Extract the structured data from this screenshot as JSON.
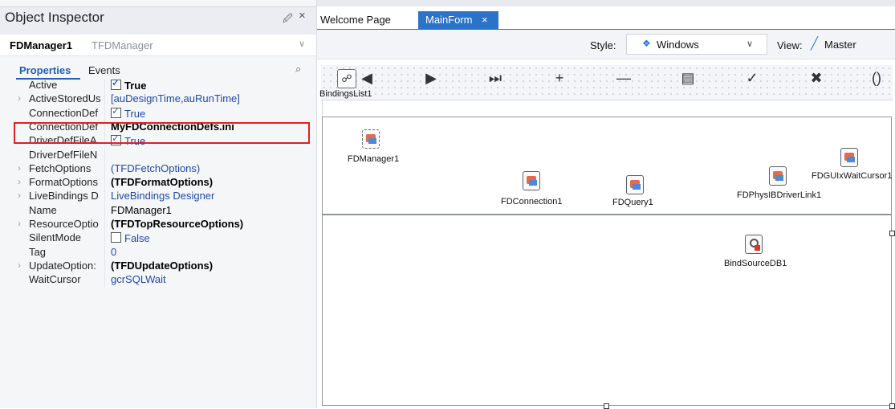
{
  "inspector": {
    "title": "Object Inspector",
    "pin": "⊣",
    "close": "×",
    "component_name": "FDManager1",
    "component_type": "TFDManager",
    "tabs": [
      "Properties",
      "Events"
    ],
    "properties": [
      {
        "name": "Active",
        "value": "True",
        "style": "checkbox-bold",
        "checked": true,
        "expandable": false
      },
      {
        "name": "ActiveStoredUs",
        "value": "[auDesignTime,auRunTime]",
        "style": "link",
        "expandable": true
      },
      {
        "name": "ConnectionDef",
        "value": "True",
        "style": "checkbox",
        "checked": true,
        "expandable": false
      },
      {
        "name": "ConnectionDef",
        "value": "MyFDConnectionDefs.ini",
        "style": "bold",
        "expandable": false
      },
      {
        "name": "DriverDefFileA",
        "value": "True",
        "style": "checkbox",
        "checked": true,
        "expandable": false
      },
      {
        "name": "DriverDefFileN",
        "value": "",
        "style": "plain",
        "expandable": false
      },
      {
        "name": "FetchOptions",
        "value": "(TFDFetchOptions)",
        "style": "link",
        "expandable": true
      },
      {
        "name": "FormatOptions",
        "value": "(TFDFormatOptions)",
        "style": "bold",
        "expandable": true
      },
      {
        "name": "LiveBindings D",
        "value": "LiveBindings Designer",
        "style": "link",
        "expandable": true
      },
      {
        "name": "Name",
        "value": "FDManager1",
        "style": "plain",
        "expandable": false
      },
      {
        "name": "ResourceOptio",
        "value": "(TFDTopResourceOptions)",
        "style": "bold",
        "expandable": true
      },
      {
        "name": "SilentMode",
        "value": "False",
        "style": "checkbox",
        "checked": false,
        "expandable": false
      },
      {
        "name": "Tag",
        "value": "0",
        "style": "link",
        "expandable": false
      },
      {
        "name": "UpdateOption:",
        "value": "(TFDUpdateOptions)",
        "style": "bold",
        "expandable": true
      },
      {
        "name": "WaitCursor",
        "value": "gcrSQLWait",
        "style": "link",
        "expandable": false
      }
    ]
  },
  "editor": {
    "tabs": [
      {
        "label": "Welcome Page",
        "active": false
      },
      {
        "label": "MainForm",
        "active": true
      }
    ],
    "tab_close": "×",
    "style_label": "Style:",
    "style_value": "Windows",
    "view_label": "View:",
    "view_value": "Master"
  },
  "designer": {
    "navigator_buttons": [
      "◀",
      "▶",
      "⏭",
      "+",
      "—",
      "▤",
      "✓",
      "✖",
      "()"
    ],
    "components": {
      "bindings_list": "BindingsList1",
      "fd_manager": "FDManager1",
      "fd_connection": "FDConnection1",
      "fd_query": "FDQuery1",
      "fd_phys_ib": "FDPhysIBDriverLink1",
      "fd_gui_wait": "FDGUIxWaitCursor1",
      "bind_source": "BindSourceDB1"
    }
  }
}
